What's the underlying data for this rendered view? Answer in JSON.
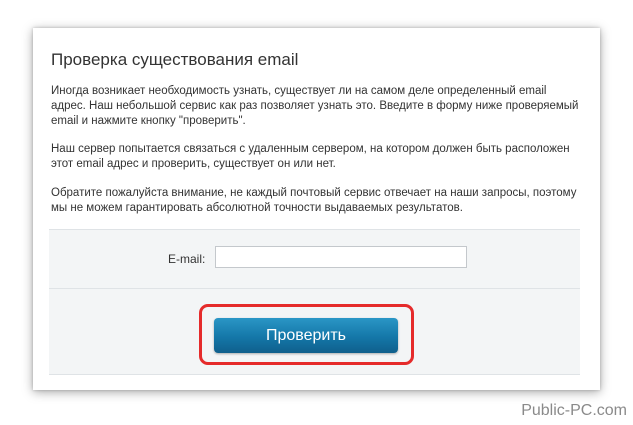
{
  "card": {
    "title": "Проверка существования email",
    "paragraphs": [
      "Иногда возникает необходимость узнать, существует ли на самом деле определенный email адрес. Наш небольшой сервис как раз позволяет узнать это. Введите в форму ниже проверяемый email и нажмите кнопку \"проверить\".",
      "Наш сервер попытается связаться с удаленным сервером, на котором должен быть расположен этот email адрес и проверить, существует он или нет.",
      "Обратите пожалуйста внимание, не каждый почтовый сервис отвечает на наши запросы, поэтому мы не можем гарантировать абсолютной точности выдаваемых результатов."
    ]
  },
  "form": {
    "email_label": "E-mail:",
    "email_value": "",
    "email_placeholder": "",
    "submit_label": "Проверить"
  },
  "watermark": "Public-PC.com",
  "colors": {
    "button": "#1477a8",
    "highlight": "#e52b2b",
    "form_background": "#f3f5f6"
  }
}
